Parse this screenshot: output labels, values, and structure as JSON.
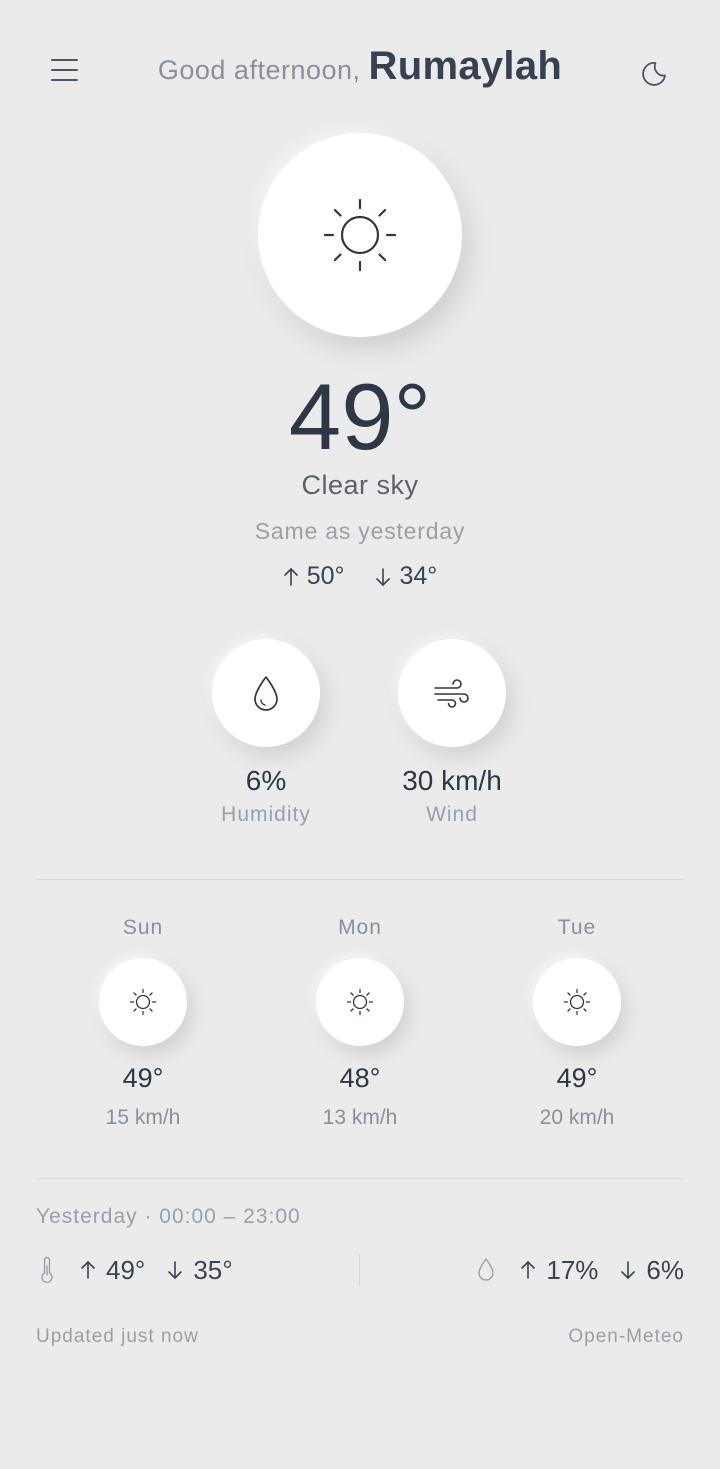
{
  "header": {
    "greeting_prefix": "Good afternoon, ",
    "user_name": "Rumaylah",
    "menu_icon": "hamburger-icon",
    "theme_icon": "moon-icon"
  },
  "current": {
    "icon": "sun-icon",
    "temperature": "49°",
    "condition": "Clear sky",
    "comparison": "Same as yesterday",
    "high": "50°",
    "low": "34°"
  },
  "stats": {
    "humidity": {
      "value": "6%",
      "label": "Humidity",
      "icon": "droplet-icon"
    },
    "wind": {
      "value": "30 km/h",
      "label": "Wind",
      "icon": "wind-icon"
    }
  },
  "forecast": [
    {
      "day": "Sun",
      "icon": "sun-icon",
      "temp": "49°",
      "wind": "15 km/h"
    },
    {
      "day": "Mon",
      "icon": "sun-icon",
      "temp": "48°",
      "wind": "13 km/h"
    },
    {
      "day": "Tue",
      "icon": "sun-icon",
      "temp": "49°",
      "wind": "20 km/h"
    }
  ],
  "yesterday": {
    "title": "Yesterday · 00:00 – 23:00",
    "temp_high": "49°",
    "temp_low": "35°",
    "humidity_high": "17%",
    "humidity_low": "6%"
  },
  "footer": {
    "updated": "Updated just now",
    "source": "Open-Meteo"
  },
  "colors": {
    "background": "#ebebeb",
    "card": "#ffffff",
    "text_primary": "#2e3745",
    "text_muted": "#9aa0a8"
  }
}
